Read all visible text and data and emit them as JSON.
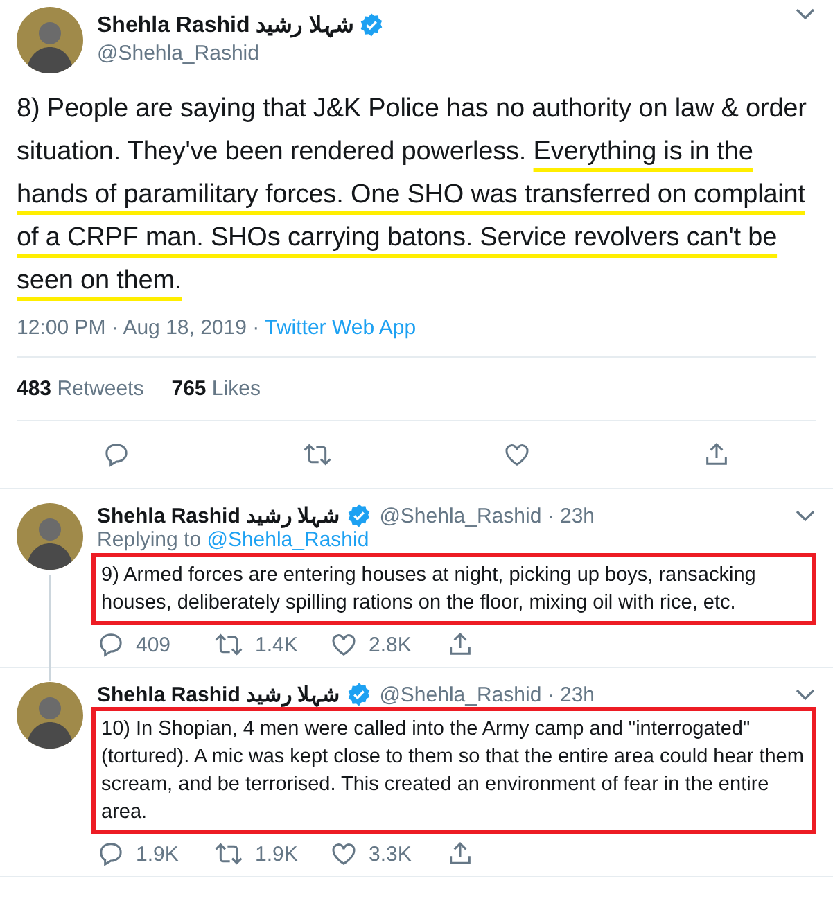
{
  "main_tweet": {
    "display_name": "Shehla Rashid",
    "display_name_urdu": "شہلا رشید",
    "verified": true,
    "handle": "@Shehla_Rashid",
    "text_segments": [
      {
        "text": "8) People are saying that J&K Police has no authority on law & order situation. They've been rendered powerless. ",
        "underlined": false
      },
      {
        "text": "Everything is in the hands of paramilitary forces. One SHO was transferred on complaint of a CRPF man. SHOs carrying batons. Service revolvers can't be seen on them.",
        "underlined": true
      }
    ],
    "timestamp": "12:00 PM · Aug 18, 2019 ·",
    "source": "Twitter Web App",
    "stats": [
      {
        "count": "483",
        "label": "Retweets"
      },
      {
        "count": "765",
        "label": "Likes"
      }
    ]
  },
  "replies": [
    {
      "display_name": "Shehla Rashid",
      "display_name_urdu": "شہلا رشید",
      "verified": true,
      "handle_time": "@Shehla_Rashid · 23h",
      "replying_to_label": "Replying to",
      "replying_to": "@Shehla_Rashid",
      "text": "9) Armed forces are entering houses at night, picking up boys, ransacking houses, deliberately spilling rations on the floor, mixing oil with rice, etc.",
      "boxed": true,
      "thread_continues": true,
      "counts": [
        "409",
        "1.4K",
        "2.8K"
      ]
    },
    {
      "display_name": "Shehla Rashid",
      "display_name_urdu": "شہلا رشید",
      "verified": true,
      "handle_time": "@Shehla_Rashid · 23h",
      "text": "10) In Shopian, 4 men were called into the Army camp and \"interrogated\" (tortured). A mic was kept close to them so that the entire area could hear them scream, and be terrorised. This created an environment of fear in the entire area.",
      "boxed": true,
      "thread_continues": false,
      "counts": [
        "1.9K",
        "1.9K",
        "3.3K"
      ]
    }
  ]
}
